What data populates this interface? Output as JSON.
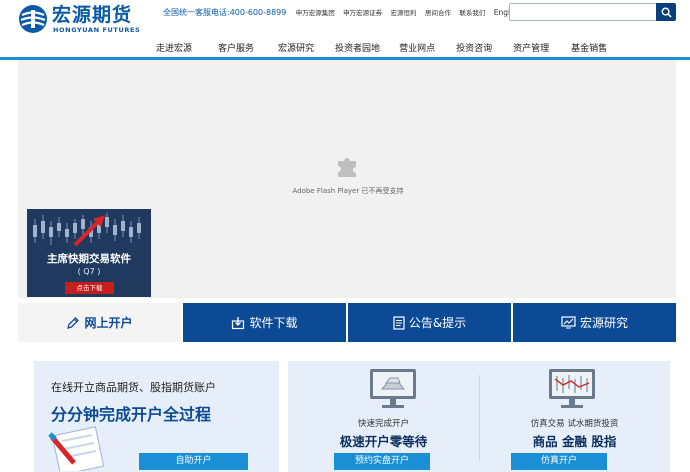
{
  "header": {
    "logo_cn": "宏源期货",
    "logo_en": "HONGYUAN FUTURES",
    "hotline": "全国统一客服电话:400-600-8899",
    "top_links": [
      "申万宏源集团",
      "申万宏源证券",
      "宏源恒利",
      "居间合作",
      "联系我们"
    ],
    "english": "English",
    "search_placeholder": ""
  },
  "nav": {
    "items": [
      "走进宏源",
      "客户服务",
      "宏源研究",
      "投资者园地",
      "营业网点",
      "投资咨询",
      "资产管理",
      "基金销售"
    ]
  },
  "banner": {
    "flash_notice": "Adobe Flash Player 已不再受支持",
    "promo_title": "主席快期交易软件",
    "promo_sub": "( Q7 )",
    "promo_button": "点击下载"
  },
  "tabs": [
    {
      "label": "网上开户",
      "icon": "pencil-icon"
    },
    {
      "label": "软件下载",
      "icon": "download-icon"
    },
    {
      "label": "公告&提示",
      "icon": "document-icon"
    },
    {
      "label": "宏源研究",
      "icon": "chart-icon"
    }
  ],
  "open_account": {
    "line1": "在线开立商品期货、股指期货账户",
    "line2": "分分钟完成开户全过程",
    "button": "自助开户"
  },
  "quick_open": {
    "small": "快速完成开户",
    "big": "极速开户零等待",
    "button": "预约实盘开户"
  },
  "sim_trade": {
    "small": "仿真交易  试水期货投资",
    "big": "商品  金融  股指",
    "button": "仿真开户"
  },
  "colors": {
    "brand_blue": "#0a5aa8",
    "tab_blue": "#0d4a96",
    "button_blue": "#1a8fd6",
    "promo_red": "#c41e1e"
  }
}
